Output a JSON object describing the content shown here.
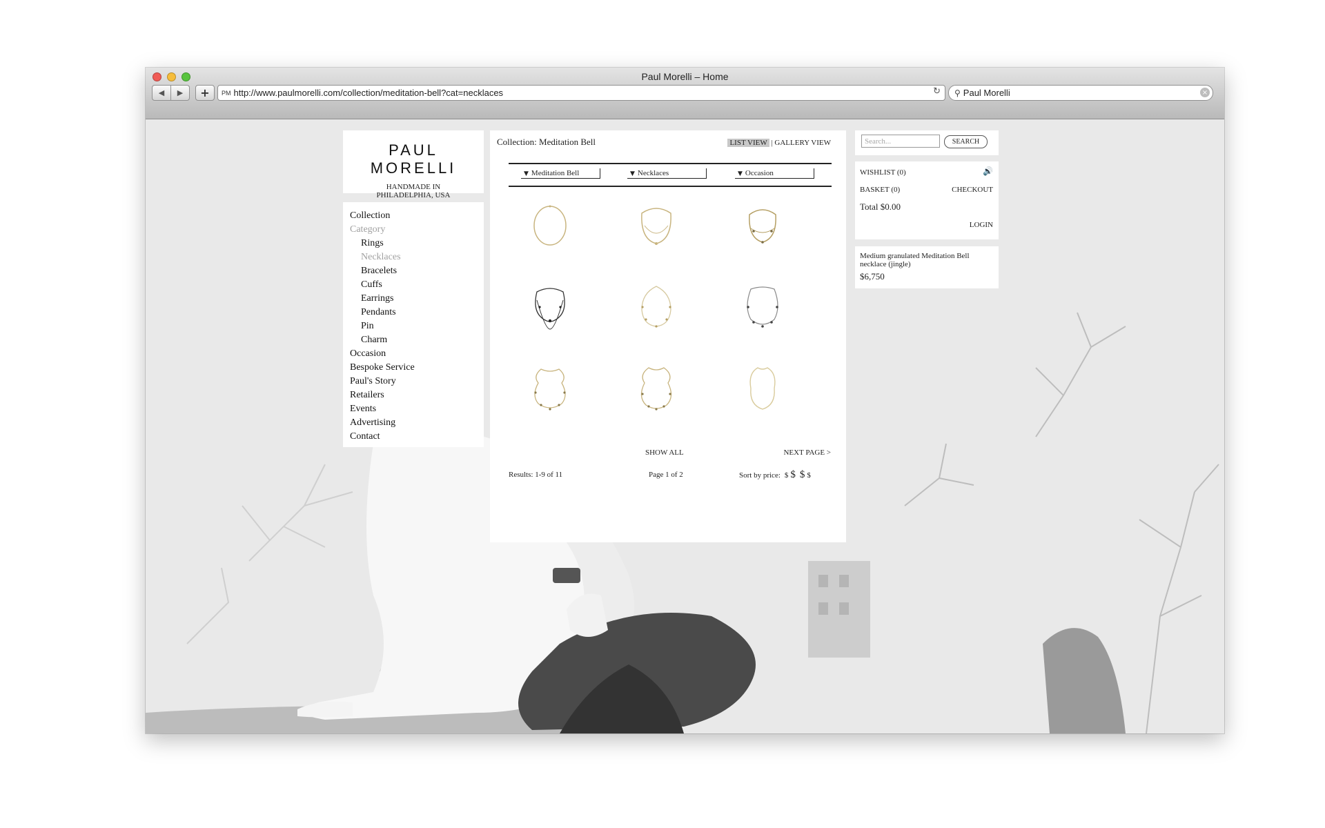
{
  "browser": {
    "title": "Paul Morelli – Home",
    "url": "http://www.paulmorelli.com/collection/meditation-bell?cat=necklaces",
    "url_prefix": "PM",
    "search_query": "Paul Morelli",
    "icons": [
      "back-icon",
      "forward-icon",
      "plus-icon",
      "reload-icon",
      "search-icon",
      "clear-icon"
    ]
  },
  "brand": {
    "logo": "PAUL MORELLI",
    "tagline_line1": "HANDMADE IN",
    "tagline_line2": "PHILADELPHIA, USA"
  },
  "menu": {
    "collection": "Collection",
    "category": "Category",
    "categories": [
      "Rings",
      "Necklaces",
      "Bracelets",
      "Cuffs",
      "Earrings",
      "Pendants",
      "Pin",
      "Charm"
    ],
    "active_category": "Necklaces",
    "items": [
      "Occasion",
      "Bespoke Service",
      "Paul's Story",
      "Retailers",
      "Events",
      "Advertising",
      "Contact"
    ]
  },
  "main": {
    "collection_title": "Collection: Meditation Bell",
    "list_view": "LIST VIEW",
    "gallery_view": "GALLERY VIEW",
    "view_separator": "|",
    "filters": [
      "Meditation Bell",
      "Necklaces",
      "Occasion"
    ],
    "show_all": "SHOW ALL",
    "next_page": "NEXT PAGE >",
    "results": "Results: 1-9 of 11",
    "page": "Page 1 of 2",
    "sort_label": "Sort by price:",
    "sort_glyph_1": "$",
    "sort_glyph_2": "$",
    "sort_glyph_3": "$",
    "sort_glyph_4": "$"
  },
  "sidebar": {
    "search_placeholder": "Search...",
    "search_button": "SEARCH",
    "wishlist": "WISHLIST (0)",
    "basket": "BASKET (0)",
    "checkout": "CHECKOUT",
    "total": "Total $0.00",
    "login": "LOGIN",
    "product_name": "Medium granulated Meditation Bell necklace (jingle)",
    "product_price": "$6,750"
  },
  "colors": {
    "gold": "#c8b47e",
    "dark_chain": "#333333",
    "panel_bg": "#ffffff",
    "photo_bg": "#e9e9e9"
  }
}
